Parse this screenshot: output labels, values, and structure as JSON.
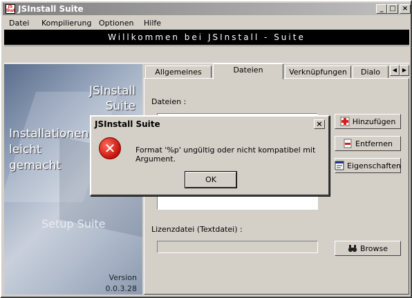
{
  "window": {
    "title": "JSInstall Suite"
  },
  "menu": [
    {
      "label": "Datei"
    },
    {
      "label": "Kompilierung"
    },
    {
      "label": "Optionen"
    },
    {
      "label": "Hilfe"
    }
  ],
  "banner": {
    "text": "Willkommen bei JSInstall - Suite"
  },
  "sidebar": {
    "title_line1": "JSInstall",
    "title_line2": "Suite",
    "slogan_line1": "Installationen",
    "slogan_line2": "leicht",
    "slogan_line3": "gemacht",
    "watermark": "Setup Suite",
    "version_label": "Version",
    "version": "0.0.3.28"
  },
  "tabs": [
    {
      "label": "Allgemeines"
    },
    {
      "label": "Dateien",
      "active": true
    },
    {
      "label": "Verknüpfungen"
    },
    {
      "label": "Dialo"
    }
  ],
  "panel": {
    "files_label": "Dateien :",
    "license_label": "Lizenzdatei (Textdatei) :",
    "add_button": "Hinzufügen",
    "remove_button": "Entfernen",
    "properties_button": "Eigenschaften",
    "browse_button": "Browse"
  },
  "dialog": {
    "title": "JSInstall Suite",
    "message": "Format '%p' ungültig oder nicht kompatibel mit Argument.",
    "ok_button": "OK",
    "icon": "error-icon"
  },
  "colors": {
    "titlebar_start": "#808080",
    "titlebar_end": "#c0c0c0",
    "banner_bg": "#000000",
    "error_red": "#c4120a"
  }
}
